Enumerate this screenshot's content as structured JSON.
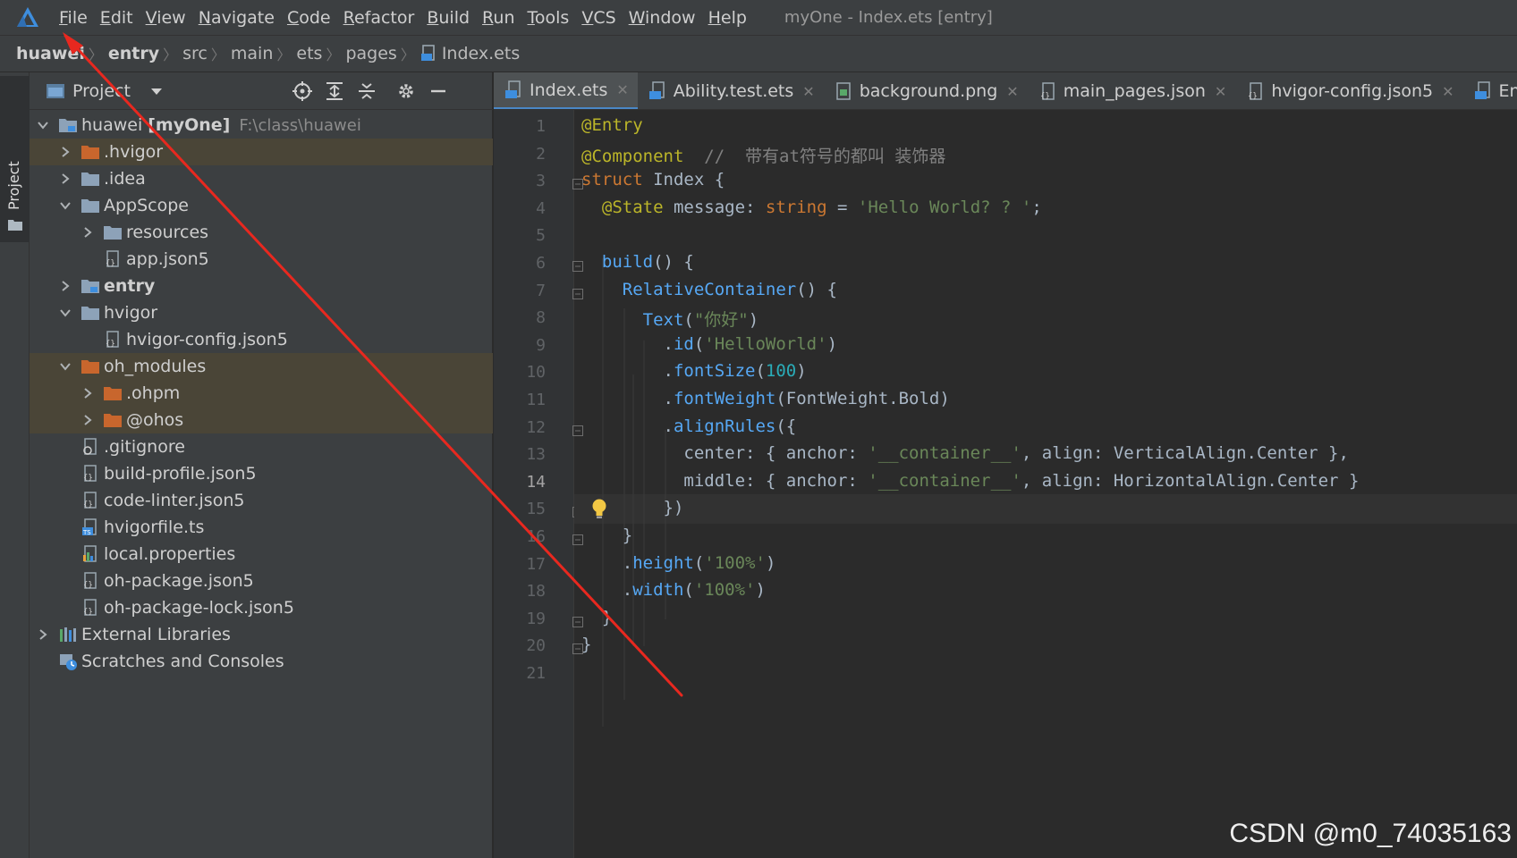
{
  "menubar": {
    "items": [
      {
        "mnemonic": "F",
        "rest": "ile"
      },
      {
        "mnemonic": "E",
        "rest": "dit"
      },
      {
        "mnemonic": "V",
        "rest": "iew"
      },
      {
        "mnemonic": "N",
        "rest": "avigate"
      },
      {
        "mnemonic": "C",
        "rest": "ode"
      },
      {
        "mnemonic": "R",
        "rest": "efactor"
      },
      {
        "mnemonic": "B",
        "rest": "uild"
      },
      {
        "mnemonic": "R",
        "rest": "un"
      },
      {
        "mnemonic": "T",
        "rest": "ools"
      },
      {
        "mnemonic": "V",
        "rest": "CS"
      },
      {
        "mnemonic": "W",
        "rest": "indow"
      },
      {
        "mnemonic": "H",
        "rest": "elp"
      }
    ],
    "window_title": "myOne - Index.ets [entry]"
  },
  "breadcrumb": {
    "items": [
      "huawei",
      "entry",
      "src",
      "main",
      "ets",
      "pages",
      "Index.ets"
    ]
  },
  "tool_stripe": {
    "project_label": "Project"
  },
  "project_panel": {
    "title": "Project",
    "tree": [
      {
        "label": "huawei",
        "suffix": "[myOne]",
        "path": "F:\\class\\huawei",
        "depth": 0,
        "arrow": "down",
        "icon": "module-folder-icon"
      },
      {
        "label": ".hvigor",
        "depth": 1,
        "arrow": "right",
        "icon": "orange-folder-icon",
        "hl": true
      },
      {
        "label": ".idea",
        "depth": 1,
        "arrow": "right",
        "icon": "folder-icon"
      },
      {
        "label": "AppScope",
        "depth": 1,
        "arrow": "down",
        "icon": "folder-icon"
      },
      {
        "label": "resources",
        "depth": 2,
        "arrow": "right",
        "icon": "folder-icon"
      },
      {
        "label": "app.json5",
        "depth": 2,
        "arrow": "",
        "icon": "json-file-icon"
      },
      {
        "label": "entry",
        "depth": 1,
        "arrow": "right",
        "icon": "module-folder-icon",
        "bold": true
      },
      {
        "label": "hvigor",
        "depth": 1,
        "arrow": "down",
        "icon": "folder-icon"
      },
      {
        "label": "hvigor-config.json5",
        "depth": 2,
        "arrow": "",
        "icon": "json-file-icon"
      },
      {
        "label": "oh_modules",
        "depth": 1,
        "arrow": "down",
        "icon": "orange-folder-icon",
        "hl": true
      },
      {
        "label": ".ohpm",
        "depth": 2,
        "arrow": "right",
        "icon": "orange-folder-icon",
        "hl": true
      },
      {
        "label": "@ohos",
        "depth": 2,
        "arrow": "right",
        "icon": "orange-folder-icon",
        "hl": true
      },
      {
        "label": ".gitignore",
        "depth": 1,
        "arrow": "",
        "icon": "gitignore-file-icon"
      },
      {
        "label": "build-profile.json5",
        "depth": 1,
        "arrow": "",
        "icon": "json-file-icon"
      },
      {
        "label": "code-linter.json5",
        "depth": 1,
        "arrow": "",
        "icon": "json-file-icon"
      },
      {
        "label": "hvigorfile.ts",
        "depth": 1,
        "arrow": "",
        "icon": "ts-file-icon"
      },
      {
        "label": "local.properties",
        "depth": 1,
        "arrow": "",
        "icon": "properties-file-icon"
      },
      {
        "label": "oh-package.json5",
        "depth": 1,
        "arrow": "",
        "icon": "json-file-icon"
      },
      {
        "label": "oh-package-lock.json5",
        "depth": 1,
        "arrow": "",
        "icon": "json-file-icon"
      },
      {
        "label": "External Libraries",
        "depth": 0,
        "arrow": "right",
        "icon": "libraries-icon"
      },
      {
        "label": "Scratches and Consoles",
        "depth": 0,
        "arrow": "",
        "icon": "scratches-icon"
      }
    ]
  },
  "editor_tabs": [
    {
      "label": "Index.ets",
      "active": true
    },
    {
      "label": "Ability.test.ets",
      "active": false
    },
    {
      "label": "background.png",
      "active": false
    },
    {
      "label": "main_pages.json",
      "active": false
    },
    {
      "label": "hvigor-config.json5",
      "active": false
    },
    {
      "label": "EntryAb",
      "active": false
    }
  ],
  "editor": {
    "line_numbers": [
      "1",
      "2",
      "3",
      "4",
      "5",
      "6",
      "7",
      "8",
      "9",
      "10",
      "11",
      "12",
      "13",
      "14",
      "15",
      "16",
      "17",
      "18",
      "19",
      "20",
      "21"
    ],
    "lines": [
      [
        [
          "ann",
          "@Entry"
        ]
      ],
      [
        [
          "ann",
          "@Component"
        ],
        [
          "plain",
          "  "
        ],
        [
          "cmt",
          "//  带有at符号的都叫 装饰器"
        ]
      ],
      [
        [
          "kw",
          "struct "
        ],
        [
          "plain",
          "Index {"
        ]
      ],
      [
        [
          "plain",
          "  "
        ],
        [
          "ann",
          "@State "
        ],
        [
          "plain",
          "message: "
        ],
        [
          "kw",
          "string"
        ],
        [
          "plain",
          " = "
        ],
        [
          "str",
          "'Hello World? ? '"
        ],
        [
          "plain",
          ";"
        ]
      ],
      [],
      [
        [
          "plain",
          "  "
        ],
        [
          "fn",
          "build"
        ],
        [
          "plain",
          "() {"
        ]
      ],
      [
        [
          "plain",
          "    "
        ],
        [
          "fn",
          "RelativeContainer"
        ],
        [
          "plain",
          "() {"
        ]
      ],
      [
        [
          "plain",
          "      "
        ],
        [
          "fn",
          "Text"
        ],
        [
          "plain",
          "("
        ],
        [
          "str",
          "\"你好\""
        ],
        [
          "plain",
          ")"
        ]
      ],
      [
        [
          "plain",
          "        ."
        ],
        [
          "fn",
          "id"
        ],
        [
          "plain",
          "("
        ],
        [
          "str",
          "'HelloWorld'"
        ],
        [
          "plain",
          ")"
        ]
      ],
      [
        [
          "plain",
          "        ."
        ],
        [
          "fn",
          "fontSize"
        ],
        [
          "plain",
          "("
        ],
        [
          "num",
          "100"
        ],
        [
          "plain",
          ")"
        ]
      ],
      [
        [
          "plain",
          "        ."
        ],
        [
          "fn",
          "fontWeight"
        ],
        [
          "plain",
          "(FontWeight.Bold)"
        ]
      ],
      [
        [
          "plain",
          "        ."
        ],
        [
          "fn",
          "alignRules"
        ],
        [
          "plain",
          "({"
        ]
      ],
      [
        [
          "plain",
          "          center: { anchor: "
        ],
        [
          "str",
          "'__container__'"
        ],
        [
          "plain",
          ", align: VerticalAlign.Center },"
        ]
      ],
      [
        [
          "plain",
          "          middle: { anchor: "
        ],
        [
          "str",
          "'__container__'"
        ],
        [
          "plain",
          ", align: HorizontalAlign.Center }"
        ]
      ],
      [
        [
          "plain",
          "        })"
        ]
      ],
      [
        [
          "plain",
          "    }"
        ]
      ],
      [
        [
          "plain",
          "    ."
        ],
        [
          "fn",
          "height"
        ],
        [
          "plain",
          "("
        ],
        [
          "str",
          "'100%'"
        ],
        [
          "plain",
          ")"
        ]
      ],
      [
        [
          "plain",
          "    ."
        ],
        [
          "fn",
          "width"
        ],
        [
          "plain",
          "("
        ],
        [
          "str",
          "'100%'"
        ],
        [
          "plain",
          ")"
        ]
      ],
      [
        [
          "plain",
          "  }"
        ]
      ],
      [
        [
          "plain",
          "}"
        ]
      ],
      []
    ]
  },
  "watermark": "CSDN @m0_74035163",
  "colors": {
    "accent": "#4a88c7",
    "arrow_annotation": "#e8281f",
    "folder_orange": "#c8662d",
    "folder_gray": "#8da2b8"
  }
}
